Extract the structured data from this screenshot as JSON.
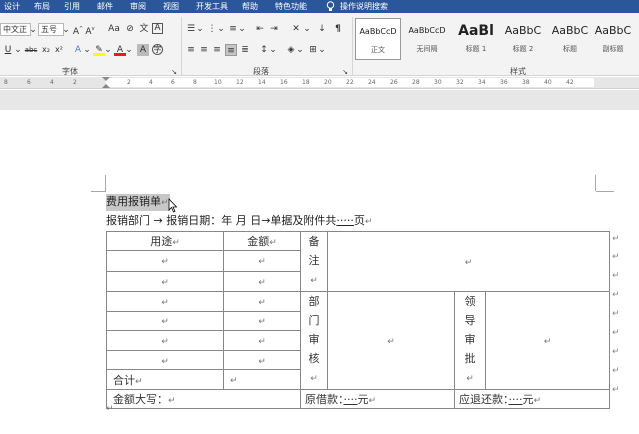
{
  "menubar": {
    "tabs": [
      "设计",
      "布局",
      "引用",
      "邮件",
      "审阅",
      "视图",
      "开发工具",
      "帮助",
      "特色功能"
    ],
    "tell_me": "操作说明搜索"
  },
  "ribbon": {
    "font_name": "中文正",
    "font_size": "五号",
    "font_group_label": "字体",
    "paragraph_group_label": "段落",
    "styles_group_label": "样式",
    "styles": [
      {
        "preview": "AaBbCcD",
        "name": "正文"
      },
      {
        "preview": "AaBbCcD",
        "name": "无间隔"
      },
      {
        "preview": "AaBl",
        "name": "标题 1"
      },
      {
        "preview": "AaBbC",
        "name": "标题 2"
      },
      {
        "preview": "AaBbC",
        "name": "标题"
      },
      {
        "preview": "AaBbC",
        "name": "副标题"
      }
    ]
  },
  "ruler": {
    "numbers": [
      "8",
      "6",
      "4",
      "2",
      "2",
      "4",
      "6",
      "8",
      "10",
      "12",
      "14",
      "16",
      "18",
      "20",
      "22",
      "24",
      "26",
      "28",
      "30",
      "32",
      "34",
      "36",
      "38",
      "40",
      "42"
    ]
  },
  "document": {
    "title": "费用报销单",
    "info_line": "报销部门 → 报销日期：年 月 日→单据及附件共",
    "info_blank": "·····",
    "info_unit": "页",
    "para_mark": "↵",
    "table": {
      "col_usage": "用途",
      "col_amount": "金额",
      "remarks_label": "备注",
      "dept_review_label": "部门审核",
      "leader_approval_label": "领导审批",
      "total_label": "合计",
      "amount_in_words_label": "金额大写：",
      "original_loan_label": "原借款：",
      "original_loan_blank": "····",
      "original_loan_unit": "元",
      "refund_label": "应退还款：",
      "refund_blank": "····",
      "refund_unit": "元"
    }
  }
}
